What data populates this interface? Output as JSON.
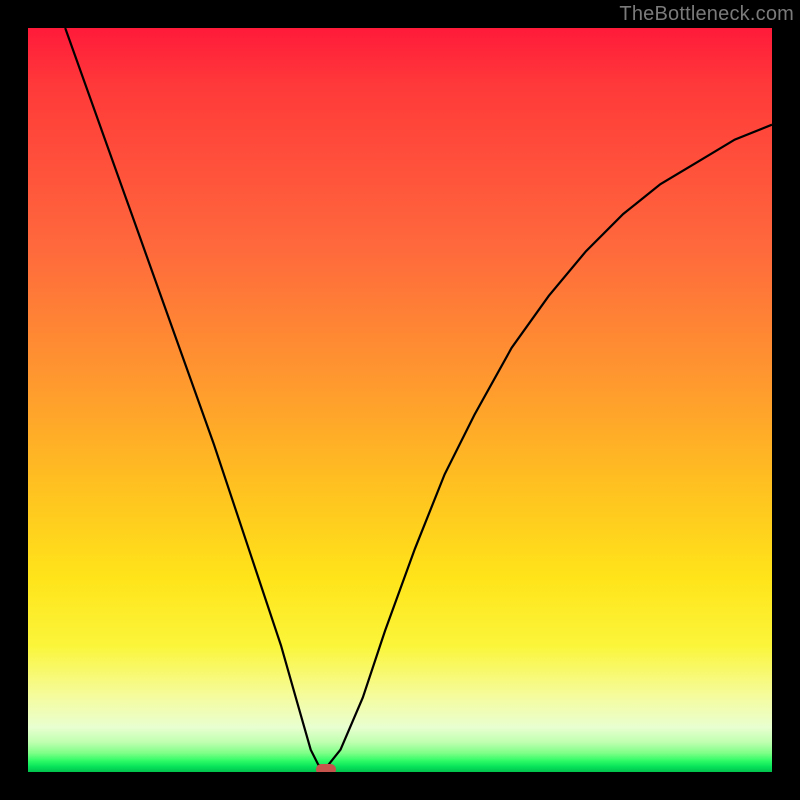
{
  "watermark": "TheBottleneck.com",
  "chart_data": {
    "type": "line",
    "title": "",
    "xlabel": "",
    "ylabel": "",
    "xlim": [
      0,
      100
    ],
    "ylim": [
      0,
      100
    ],
    "grid": false,
    "legend": false,
    "series": [
      {
        "name": "bottleneck-curve",
        "x": [
          5,
          10,
          15,
          20,
          25,
          30,
          32,
          34,
          36,
          38,
          39,
          40,
          42,
          45,
          48,
          52,
          56,
          60,
          65,
          70,
          75,
          80,
          85,
          90,
          95,
          100
        ],
        "y": [
          100,
          86,
          72,
          58,
          44,
          29,
          23,
          17,
          10,
          3,
          1,
          0.5,
          3,
          10,
          19,
          30,
          40,
          48,
          57,
          64,
          70,
          75,
          79,
          82,
          85,
          87
        ]
      }
    ],
    "background_gradient_stops": [
      {
        "pos": 0.0,
        "color": "#ff1a3a"
      },
      {
        "pos": 0.3,
        "color": "#ff6a3c"
      },
      {
        "pos": 0.62,
        "color": "#ffc220"
      },
      {
        "pos": 0.83,
        "color": "#fbf53a"
      },
      {
        "pos": 0.94,
        "color": "#e8ffd0"
      },
      {
        "pos": 0.985,
        "color": "#2dfb66"
      },
      {
        "pos": 1.0,
        "color": "#02c24d"
      }
    ],
    "marker": {
      "x": 40,
      "y": 0,
      "color": "#c4544c"
    }
  }
}
